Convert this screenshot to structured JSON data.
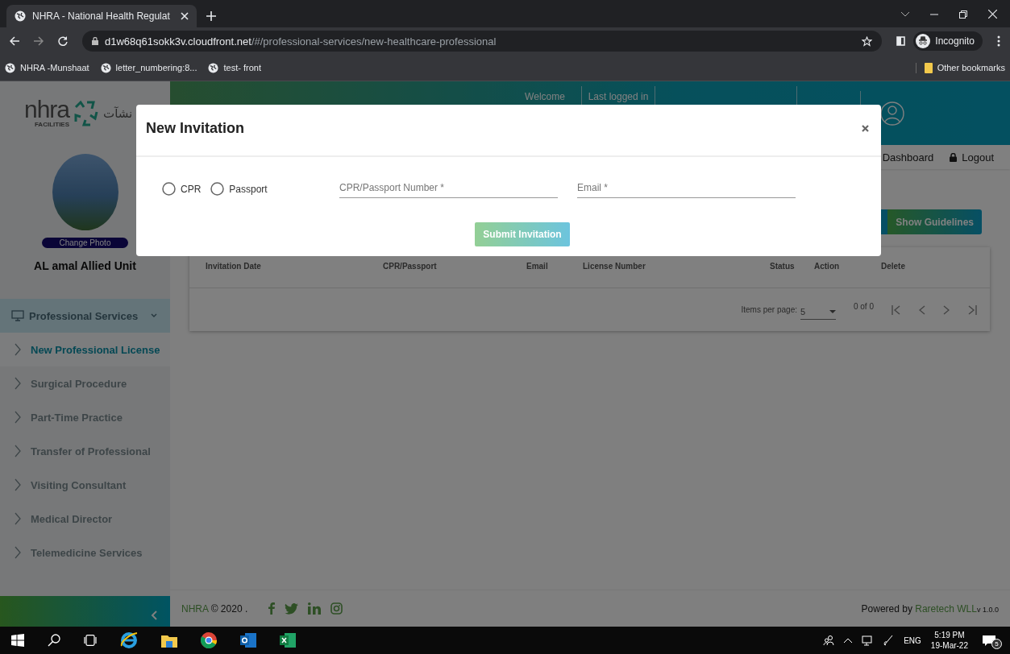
{
  "browser": {
    "tab_title": "NHRA - National Health Regulat",
    "url_host": "d1w68q61sokk3v.cloudfront.net",
    "url_path": "/#/professional-services/new-healthcare-professional",
    "profile": "Incognito",
    "bookmarks": [
      "NHRA -Munshaat",
      "letter_numbering:8...",
      "test- front"
    ],
    "other_bookmarks": "Other bookmarks"
  },
  "sidebar": {
    "logo": {
      "name": "nhra",
      "sub": "FACILITIES",
      "arabic": "نشآت"
    },
    "change_photo": "Change Photo",
    "unit_name": "AL amal Allied Unit",
    "menu": [
      {
        "label": "Professional Services",
        "kind": "group",
        "expanded": true
      },
      {
        "label": "New Professional License",
        "kind": "link",
        "selected": true
      },
      {
        "label": "Surgical Procedure",
        "kind": "link",
        "selected": false
      },
      {
        "label": "Part-Time Practice",
        "kind": "link",
        "selected": false
      },
      {
        "label": "Transfer of Professional",
        "kind": "link",
        "selected": false
      },
      {
        "label": "Visiting Consultant",
        "kind": "link",
        "selected": false
      },
      {
        "label": "Medical Director",
        "kind": "link",
        "selected": false
      },
      {
        "label": "Telemedicine Services",
        "kind": "link",
        "selected": false
      }
    ]
  },
  "header": {
    "welcome": "Welcome",
    "last_logged_in": "Last logged in"
  },
  "nav": [
    {
      "label": "Dashboard",
      "kind": "plain"
    },
    {
      "label": "Logout",
      "kind": "lock"
    }
  ],
  "guidelines_button": "Show Guidelines",
  "table": {
    "columns": [
      "Invitation Date",
      "CPR/Passport",
      "Email",
      "License Number",
      "Status",
      "Action",
      "Delete"
    ],
    "items_per_page_label": "Items per page:",
    "items_per_page": "5",
    "range": "0 of 0"
  },
  "footer": {
    "brand": "NHRA",
    "copyright": "© 2020 .",
    "powered_by": "Powered by",
    "company": "Raretech WLL",
    "version": "v 1.0.0"
  },
  "modal": {
    "title": "New Invitation",
    "options": [
      {
        "label": "CPR",
        "selected": false
      },
      {
        "label": "Passport",
        "selected": false
      }
    ],
    "fields": [
      {
        "placeholder": "CPR/Passport Number *"
      },
      {
        "placeholder": "Email *"
      }
    ],
    "submit": {
      "label": "Submit Invitation",
      "disabled": true
    }
  },
  "taskbar": {
    "language": "ENG",
    "time": "5:19 PM",
    "date": "19-Mar-22",
    "notifications": "5"
  }
}
